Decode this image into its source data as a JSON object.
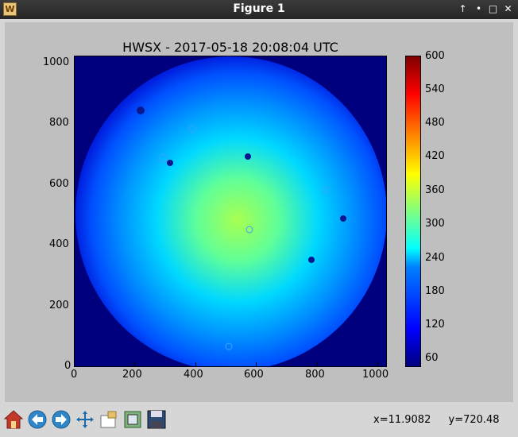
{
  "window": {
    "title": "Figure 1",
    "controls": [
      "↑",
      "•",
      "□",
      "✕"
    ]
  },
  "figure": {
    "title": "HWSX - 2017-05-18 20:08:04 UTC"
  },
  "chart_data": {
    "type": "heatmap",
    "title": "HWSX - 2017-05-18 20:08:04 UTC",
    "xlim": [
      0,
      1024
    ],
    "ylim": [
      0,
      1024
    ],
    "xticks": [
      0,
      200,
      400,
      600,
      800,
      1000
    ],
    "yticks": [
      0,
      200,
      400,
      600,
      800,
      1000
    ],
    "colorbar": {
      "colormap": "jet",
      "range": [
        30,
        600
      ],
      "ticks": [
        60,
        120,
        180,
        240,
        300,
        360,
        420,
        480,
        540,
        600
      ]
    }
  },
  "toolbar": {
    "items": [
      {
        "name": "home-button",
        "icon": "home-icon"
      },
      {
        "name": "back-button",
        "icon": "arrow-left-icon"
      },
      {
        "name": "forward-button",
        "icon": "arrow-right-icon"
      },
      {
        "name": "pan-button",
        "icon": "move-icon"
      },
      {
        "name": "zoom-button",
        "icon": "zoom-rect-icon"
      },
      {
        "name": "subplots-button",
        "icon": "subplots-icon"
      },
      {
        "name": "save-button",
        "icon": "save-icon"
      }
    ]
  },
  "status": {
    "x": "x=11.9082",
    "y": "y=720.48"
  }
}
